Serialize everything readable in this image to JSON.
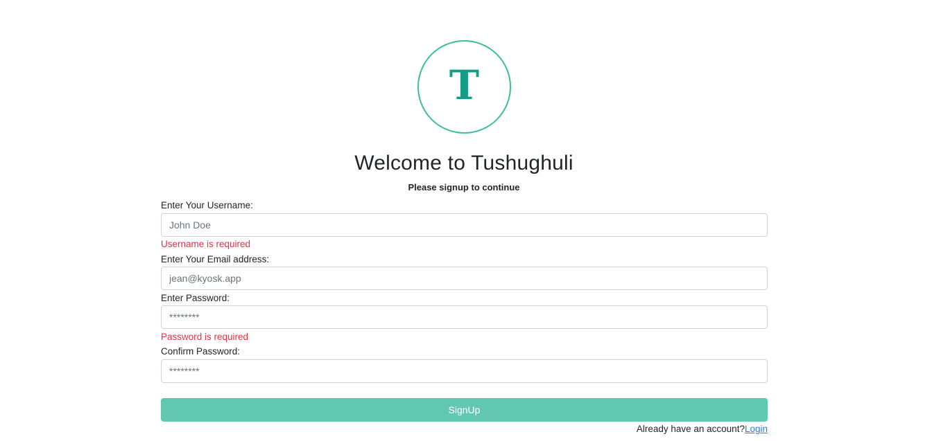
{
  "logo": {
    "letter": "T"
  },
  "header": {
    "title": "Welcome to Tushughuli",
    "subtitle": "Please signup to continue"
  },
  "form": {
    "username": {
      "label": "Enter Your Username:",
      "placeholder": "John Doe",
      "value": "",
      "error": "Username is required"
    },
    "email": {
      "label": "Enter Your Email address:",
      "placeholder": "jean@kyosk.app",
      "value": ""
    },
    "password": {
      "label": "Enter Password:",
      "placeholder": "********",
      "value": "",
      "error": "Password is required"
    },
    "confirm_password": {
      "label": "Confirm Password:",
      "placeholder": "********",
      "value": ""
    },
    "submit_label": "SignUp",
    "login_prompt": "Already have an account?",
    "login_link": "Login"
  },
  "colors": {
    "accent": "#3dbda0",
    "logo_letter": "#129e84",
    "button": "#63c8b1",
    "error": "#dc3545",
    "link": "#2a7de1"
  }
}
